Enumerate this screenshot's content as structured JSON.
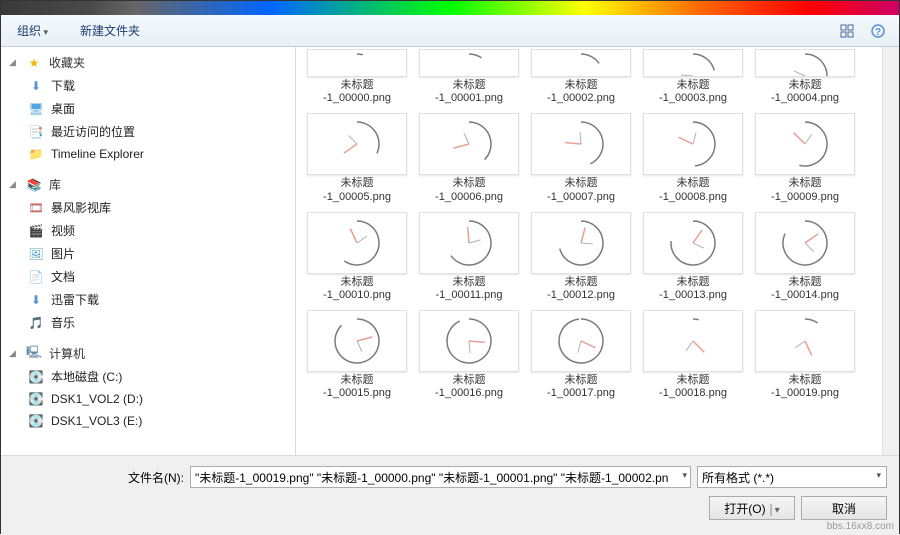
{
  "toolbar": {
    "organize": "组织",
    "new_folder": "新建文件夹"
  },
  "sidebar": {
    "favorites": {
      "label": "收藏夹",
      "items": [
        {
          "label": "下载",
          "icon": "download-icon"
        },
        {
          "label": "桌面",
          "icon": "desktop-icon"
        },
        {
          "label": "最近访问的位置",
          "icon": "recent-icon"
        },
        {
          "label": "Timeline Explorer",
          "icon": "folder-icon"
        }
      ]
    },
    "libraries": {
      "label": "库",
      "items": [
        {
          "label": "暴风影视库",
          "icon": "video-lib-icon"
        },
        {
          "label": "视频",
          "icon": "video-icon"
        },
        {
          "label": "图片",
          "icon": "picture-icon"
        },
        {
          "label": "文档",
          "icon": "document-icon"
        },
        {
          "label": "迅雷下载",
          "icon": "thunder-icon"
        },
        {
          "label": "音乐",
          "icon": "music-icon"
        }
      ]
    },
    "computer": {
      "label": "计算机",
      "items": [
        {
          "label": "本地磁盘 (C:)",
          "icon": "disk-icon"
        },
        {
          "label": "DSK1_VOL2 (D:)",
          "icon": "disk-icon"
        },
        {
          "label": "DSK1_VOL3 (E:)",
          "icon": "disk-icon"
        }
      ]
    }
  },
  "files": [
    {
      "name_l1": "未标题",
      "name_l2": "-1_00000.png",
      "angle": 15,
      "half": true
    },
    {
      "name_l1": "未标题",
      "name_l2": "-1_00001.png",
      "angle": 35,
      "half": true
    },
    {
      "name_l1": "未标题",
      "name_l2": "-1_00002.png",
      "angle": 55,
      "half": true
    },
    {
      "name_l1": "未标题",
      "name_l2": "-1_00003.png",
      "angle": 75,
      "half": true
    },
    {
      "name_l1": "未标题",
      "name_l2": "-1_00004.png",
      "angle": 95,
      "half": true
    },
    {
      "name_l1": "未标题",
      "name_l2": "-1_00005.png",
      "angle": 115
    },
    {
      "name_l1": "未标题",
      "name_l2": "-1_00006.png",
      "angle": 135
    },
    {
      "name_l1": "未标题",
      "name_l2": "-1_00007.png",
      "angle": 155
    },
    {
      "name_l1": "未标题",
      "name_l2": "-1_00008.png",
      "angle": 175
    },
    {
      "name_l1": "未标题",
      "name_l2": "-1_00009.png",
      "angle": 195
    },
    {
      "name_l1": "未标题",
      "name_l2": "-1_00010.png",
      "angle": 215
    },
    {
      "name_l1": "未标题",
      "name_l2": "-1_00011.png",
      "angle": 235
    },
    {
      "name_l1": "未标题",
      "name_l2": "-1_00012.png",
      "angle": 255
    },
    {
      "name_l1": "未标题",
      "name_l2": "-1_00013.png",
      "angle": 275
    },
    {
      "name_l1": "未标题",
      "name_l2": "-1_00014.png",
      "angle": 295
    },
    {
      "name_l1": "未标题",
      "name_l2": "-1_00015.png",
      "angle": 315
    },
    {
      "name_l1": "未标题",
      "name_l2": "-1_00016.png",
      "angle": 335
    },
    {
      "name_l1": "未标题",
      "name_l2": "-1_00017.png",
      "angle": 355
    },
    {
      "name_l1": "未标题",
      "name_l2": "-1_00018.png",
      "angle": 15
    },
    {
      "name_l1": "未标题",
      "name_l2": "-1_00019.png",
      "angle": 35
    }
  ],
  "bottom": {
    "filename_label": "文件名(N):",
    "filename_value": "\"未标题-1_00019.png\" \"未标题-1_00000.png\" \"未标题-1_00001.png\" \"未标题-1_00002.pn",
    "filter_value": "所有格式 (*.*)",
    "open_label": "打开(O)",
    "cancel_label": "取消"
  },
  "watermark": "bbs.16xx8.com"
}
